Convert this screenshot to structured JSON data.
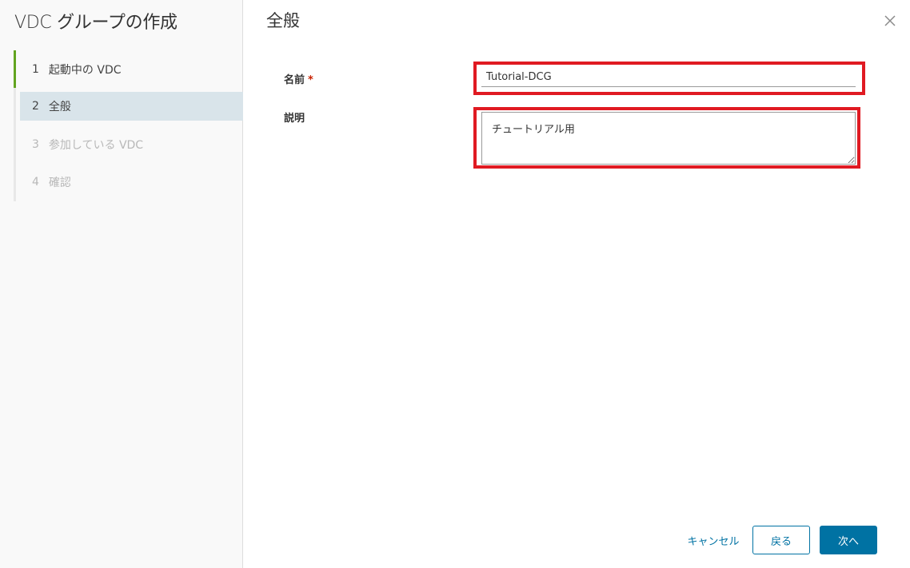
{
  "wizard": {
    "title": "VDC グループの作成",
    "steps": [
      {
        "number": "1",
        "label": "起動中の VDC",
        "state": "completed"
      },
      {
        "number": "2",
        "label": "全般",
        "state": "active"
      },
      {
        "number": "3",
        "label": "参加している VDC",
        "state": "disabled"
      },
      {
        "number": "4",
        "label": "確認",
        "state": "disabled"
      }
    ]
  },
  "content": {
    "title": "全般",
    "close_icon": "close-icon",
    "form": {
      "name_label": "名前",
      "name_required_marker": "*",
      "name_value": "Tutorial-DCG",
      "description_label": "説明",
      "description_value": "チュートリアル用"
    }
  },
  "footer": {
    "cancel_label": "キャンセル",
    "back_label": "戻る",
    "next_label": "次へ"
  },
  "colors": {
    "accent": "#0072a3",
    "completed_step": "#62a420",
    "highlight_box": "#e01a22",
    "active_step_bg": "#d9e4ea"
  }
}
